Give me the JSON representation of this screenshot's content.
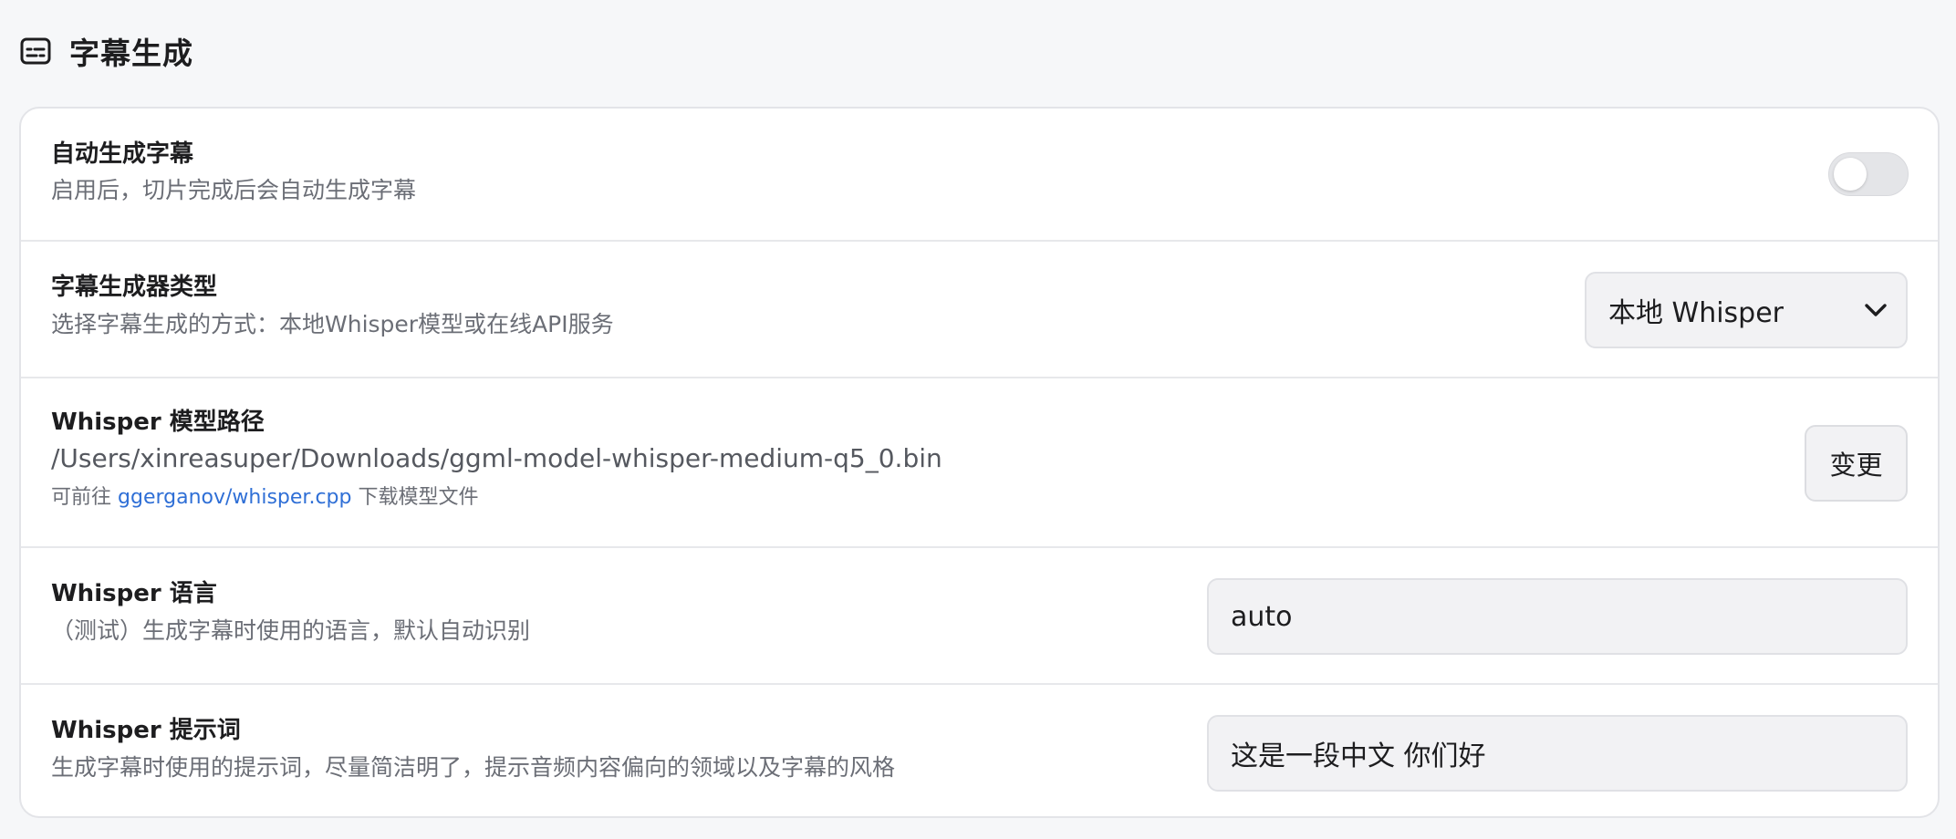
{
  "section": {
    "icon": "subtitles-icon",
    "title": "字幕生成"
  },
  "rows": {
    "auto": {
      "title": "自动生成字幕",
      "desc": "启用后，切片完成后会自动生成字幕",
      "toggle_on": false
    },
    "generator": {
      "title": "字幕生成器类型",
      "desc": "选择字幕生成的方式：本地Whisper模型或在线API服务",
      "selected": "本地 Whisper"
    },
    "model_path": {
      "title": "Whisper 模型路径",
      "path": "/Users/xinreasuper/Downloads/ggml-model-whisper-medium-q5_0.bin",
      "hint_prefix": "可前往",
      "hint_link": "ggerganov/whisper.cpp",
      "hint_suffix": "下载模型文件",
      "button_label": "变更"
    },
    "language": {
      "title": "Whisper 语言",
      "desc": "（测试）生成字幕时使用的语言，默认自动识别",
      "value": "auto"
    },
    "prompt": {
      "title": "Whisper 提示词",
      "desc": "生成字幕时使用的提示词，尽量简洁明了，提示音频内容偏向的领域以及字幕的风格",
      "value": "这是一段中文 你们好"
    }
  }
}
